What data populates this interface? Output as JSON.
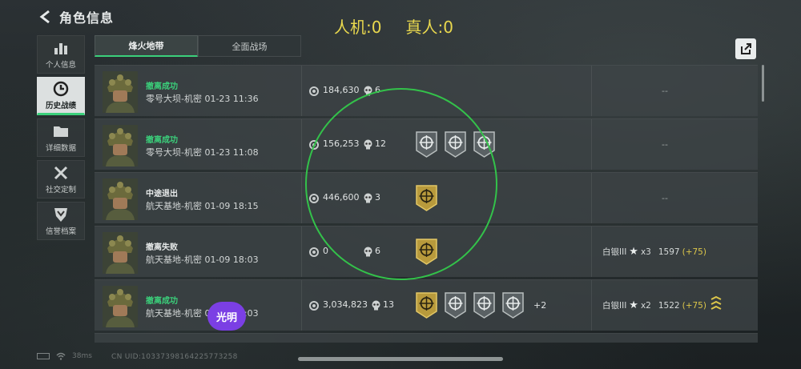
{
  "header": {
    "title": "角色信息"
  },
  "counters": {
    "ai": "人机:0",
    "human": "真人:0"
  },
  "nav": [
    {
      "label": "个人信息",
      "icon": "bar-chart-icon",
      "active": false
    },
    {
      "label": "历史战绩",
      "icon": "history-clock-icon",
      "active": true
    },
    {
      "label": "详细数据",
      "icon": "folder-icon",
      "active": false
    },
    {
      "label": "社交定制",
      "icon": "tools-icon",
      "active": false
    },
    {
      "label": "信誉档案",
      "icon": "shield-icon",
      "active": false
    }
  ],
  "tabs": [
    {
      "label": "烽火地带",
      "active": true
    },
    {
      "label": "全面战场",
      "active": false
    }
  ],
  "matches": [
    {
      "status": "撤离成功",
      "status_color": "#3bd07b",
      "map": "零号大坝-机密 01-23 11:36",
      "money": "184,630",
      "kills": "6",
      "badges": [],
      "extra": "",
      "rank": null,
      "right": "--"
    },
    {
      "status": "撤离成功",
      "status_color": "#3bd07b",
      "map": "零号大坝-机密 01-23 11:08",
      "money": "156,253",
      "kills": "12",
      "badges": [
        "gray",
        "gray",
        "gray"
      ],
      "extra": "",
      "rank": null,
      "right": "--"
    },
    {
      "status": "中途退出",
      "status_color": "#e6e9e9",
      "map": "航天基地-机密 01-09 18:15",
      "money": "446,600",
      "kills": "3",
      "badges": [
        "gold"
      ],
      "extra": "",
      "rank": null,
      "right": "--"
    },
    {
      "status": "撤离失败",
      "status_color": "#e6e9e9",
      "map": "航天基地-机密 01-09 18:03",
      "money": "0",
      "kills": "6",
      "badges": [
        "gold"
      ],
      "extra": "",
      "rank": {
        "tier": "白银III",
        "mult": "x3",
        "score": "1597",
        "delta": "(+75)"
      },
      "right": ""
    },
    {
      "status": "撤离成功",
      "status_color": "#3bd07b",
      "map": "航天基地-机密 01-09 18:03",
      "money": "3,034,823",
      "kills": "13",
      "badges": [
        "gold",
        "gray",
        "gray",
        "gray"
      ],
      "extra": "+2",
      "rank": {
        "tier": "白银III",
        "mult": "x2",
        "score": "1522",
        "delta": "(+75)"
      },
      "right": ""
    }
  ],
  "player_badge": "光明",
  "footer": {
    "ping": "38ms",
    "uid": "CN UID:10337398164225773258"
  },
  "colors": {
    "accent": "#3bd07b",
    "counter": "#e9d84e",
    "circle": "#33c24a",
    "player_badge": "#7b3fe4"
  }
}
